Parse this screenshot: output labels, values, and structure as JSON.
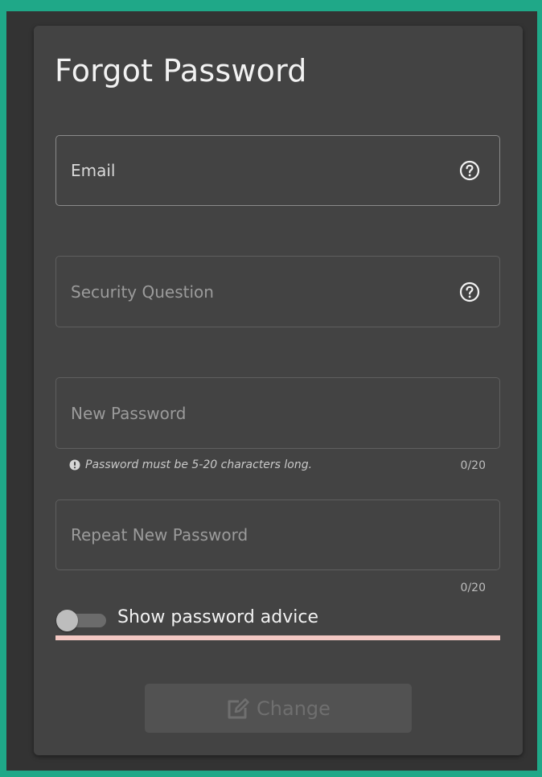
{
  "form": {
    "title": "Forgot Password",
    "email": {
      "placeholder": "Email",
      "value": ""
    },
    "security_question": {
      "placeholder": "Security Question",
      "value": ""
    },
    "new_password": {
      "placeholder": "New Password",
      "value": "",
      "hint": "Password must be 5-20 characters long.",
      "counter": "0/20"
    },
    "repeat_password": {
      "placeholder": "Repeat New Password",
      "value": "",
      "counter": "0/20"
    },
    "advice_toggle": {
      "label": "Show password advice",
      "on": false
    },
    "submit": {
      "label": "Change",
      "disabled": true
    }
  },
  "icons": {
    "help": "question-circle-icon",
    "info": "info-circle-icon",
    "edit": "edit-square-icon"
  },
  "colors": {
    "outer_border": "#1fa888",
    "background": "#333333",
    "card": "#434343",
    "divider": "#f3c8c3",
    "text": "#f2f2f2",
    "button_disabled": "#525252"
  }
}
